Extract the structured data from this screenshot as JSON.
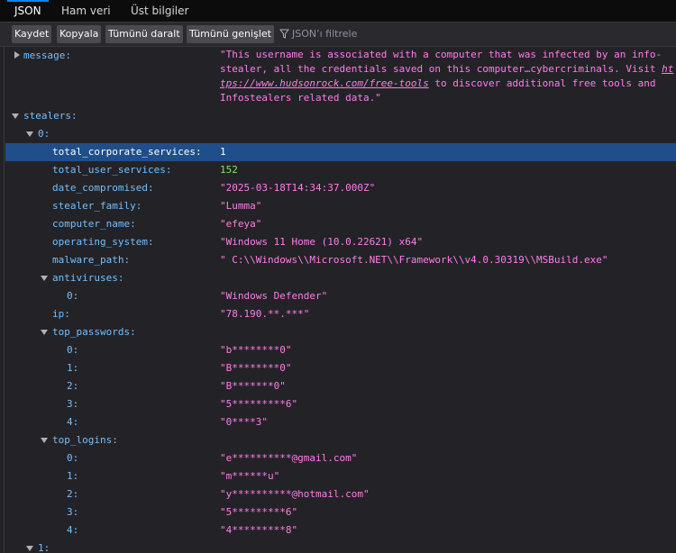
{
  "tabs": [
    "JSON",
    "Ham veri",
    "Üst bilgiler"
  ],
  "toolbar": {
    "save": "Kaydet",
    "copy": "Kopyala",
    "collapse_all": "Tümünü daralt",
    "expand_all": "Tümünü genişlet",
    "filter_placeholder": "JSON’ı filtrele"
  },
  "message": {
    "key": "message:",
    "line1": "\"This username is associated with a computer that was infected by an info-",
    "line2_pre": "stealer, all the credentials saved on this computer…cybercriminals. Visit ",
    "link_part1": "ht",
    "link_part2": "tps://www.hudsonrock.com/free-tools",
    "line3_post": " to discover additional free tools and",
    "line4": "Infostealers related data.\""
  },
  "stealers_key": "stealers:",
  "item0_key": "0:",
  "fields": {
    "total_corporate_services": {
      "key": "total_corporate_services:",
      "value": "1"
    },
    "total_user_services": {
      "key": "total_user_services:",
      "value": "152"
    },
    "date_compromised": {
      "key": "date_compromised:",
      "value": "\"2025-03-18T14:34:37.000Z\""
    },
    "stealer_family": {
      "key": "stealer_family:",
      "value": "\"Lumma\""
    },
    "computer_name": {
      "key": "computer_name:",
      "value": "\"efeya\""
    },
    "operating_system": {
      "key": "operating_system:",
      "value": "\"Windows 11 Home (10.0.22621) x64\""
    },
    "malware_path": {
      "key": "malware_path:",
      "value": "\" C:\\\\Windows\\\\Microsoft.NET\\\\Framework\\\\v4.0.30319\\\\MSBuild.exe\""
    },
    "antiviruses": {
      "key": "antiviruses:",
      "items": [
        {
          "key": "0:",
          "value": "\"Windows Defender\""
        }
      ]
    },
    "ip": {
      "key": "ip:",
      "value": "\"78.190.**.***\""
    },
    "top_passwords": {
      "key": "top_passwords:",
      "items": [
        {
          "key": "0:",
          "value": "\"b********0\""
        },
        {
          "key": "1:",
          "value": "\"B********0\""
        },
        {
          "key": "2:",
          "value": "\"B*******0\""
        },
        {
          "key": "3:",
          "value": "\"5*********6\""
        },
        {
          "key": "4:",
          "value": "\"0****3\""
        }
      ]
    },
    "top_logins": {
      "key": "top_logins:",
      "items": [
        {
          "key": "0:",
          "value": "\"e**********@gmail.com\""
        },
        {
          "key": "1:",
          "value": "\"m******u\""
        },
        {
          "key": "2:",
          "value": "\"y**********@hotmail.com\""
        },
        {
          "key": "3:",
          "value": "\"5*********6\""
        },
        {
          "key": "4:",
          "value": "\"4*********8\""
        }
      ]
    }
  },
  "item1_key": "1:"
}
